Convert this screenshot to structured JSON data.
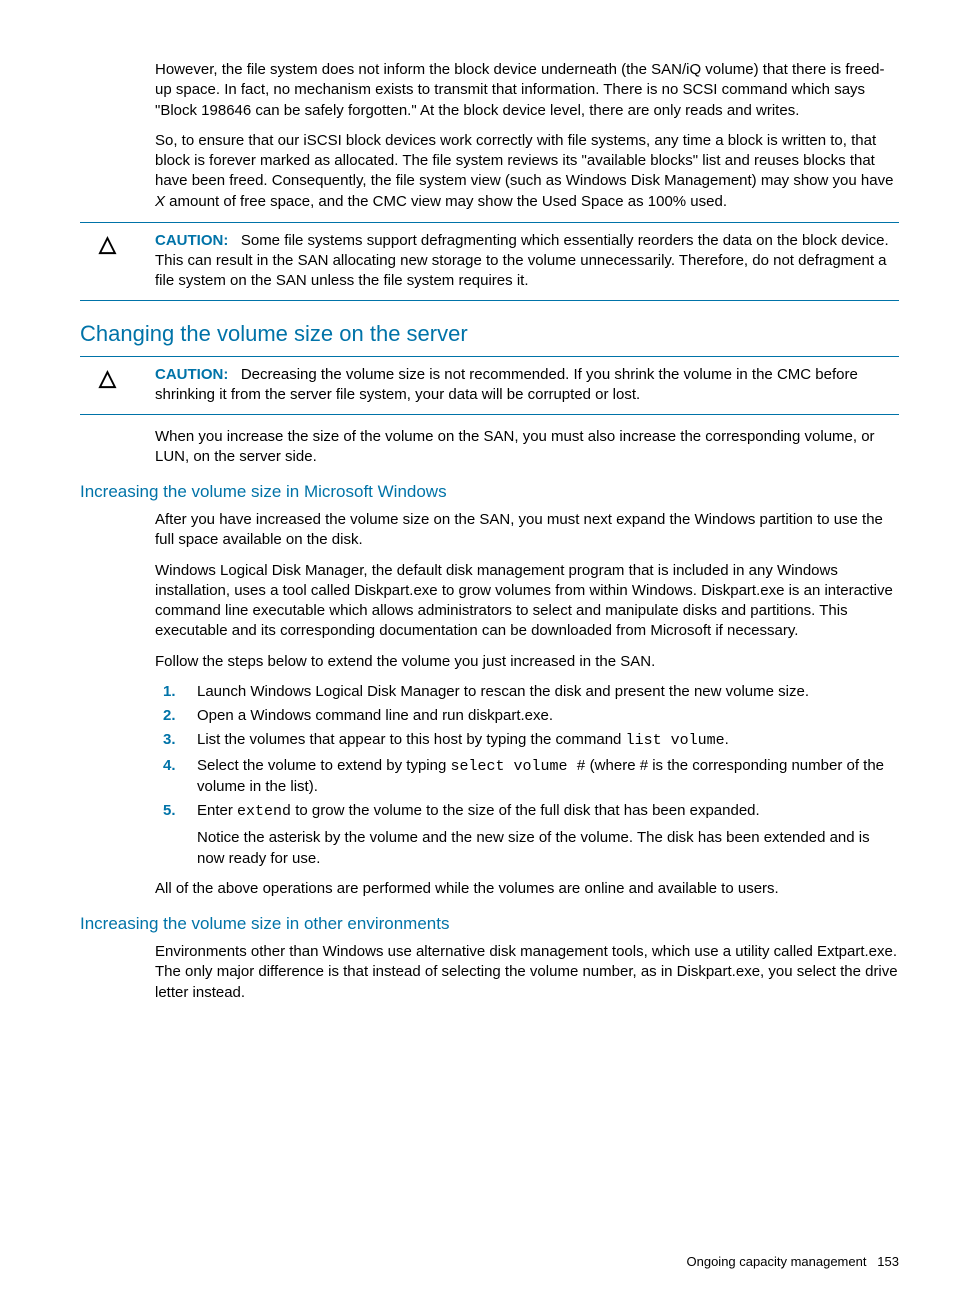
{
  "intro": {
    "p1": "However, the file system does not inform the block device underneath (the SAN/iQ volume) that there is freed-up space. In fact, no mechanism exists to transmit that information. There is no SCSI command which says \"Block 198646 can be safely forgotten.\" At the block device level, there are only reads and writes.",
    "p2a": "So, to ensure that our iSCSI block devices work correctly with file systems, any time a block is written to, that block is forever marked as allocated. The file system reviews its \"available blocks\" list and reuses blocks that have been freed. Consequently, the file system view (such as Windows Disk Management) may show you have ",
    "p2x": "X",
    "p2b": " amount of free space, and the CMC view may show the Used Space as 100% used."
  },
  "caution_icon": "△",
  "caution_label": "CAUTION:",
  "caution1_text": "Some file systems support defragmenting which essentially reorders the data on the block device. This can result in the SAN allocating new storage to the volume unnecessarily. Therefore, do not defragment a file system on the SAN unless the file system requires it.",
  "heading_main": "Changing the volume size on the server",
  "caution2_text": "Decreasing the volume size is not recommended. If you shrink the volume in the CMC before shrinking it from the server file system, your data will be corrupted or lost.",
  "after_caution2": "When you increase the size of the volume on the SAN, you must also increase the corresponding volume, or LUN, on the server side.",
  "heading_sub1": "Increasing the volume size in Microsoft Windows",
  "win_p1": "After you have increased the volume size on the SAN, you must next expand the Windows partition to use the full space available on the disk.",
  "win_p2": "Windows Logical Disk Manager, the default disk management program that is included in any Windows installation, uses a tool called Diskpart.exe to grow volumes from within Windows. Diskpart.exe is an interactive command line executable which allows administrators to select and manipulate disks and partitions. This executable and its corresponding documentation can be downloaded from Microsoft if necessary.",
  "win_p3": "Follow the steps below to extend the volume you just increased in the SAN.",
  "steps": {
    "s1": "Launch Windows Logical Disk Manager to rescan the disk and present the new volume size.",
    "s2": "Open a Windows command line and run diskpart.exe.",
    "s3a": "List the volumes that appear to this host by typing the command ",
    "s3cmd": "list volume",
    "s3b": ".",
    "s4a": "Select the volume to extend by typing ",
    "s4cmd": "select volume #",
    "s4b": " (where # is the corresponding number of the volume in the list).",
    "s5a": "Enter ",
    "s5cmd": "extend",
    "s5b": " to grow the volume to the size of the full disk that has been expanded.",
    "s5note": "Notice the asterisk by the volume and the new size of the volume. The disk has been extended and is now ready for use."
  },
  "win_p4": "All of the above operations are performed while the volumes are online and available to users.",
  "heading_sub2": "Increasing the volume size in other environments",
  "other_p1": "Environments other than Windows use alternative disk management tools, which use a utility called Extpart.exe. The only major difference is that instead of selecting the volume number, as in Diskpart.exe, you select the drive letter instead.",
  "footer_text": "Ongoing capacity management",
  "footer_page": "153"
}
